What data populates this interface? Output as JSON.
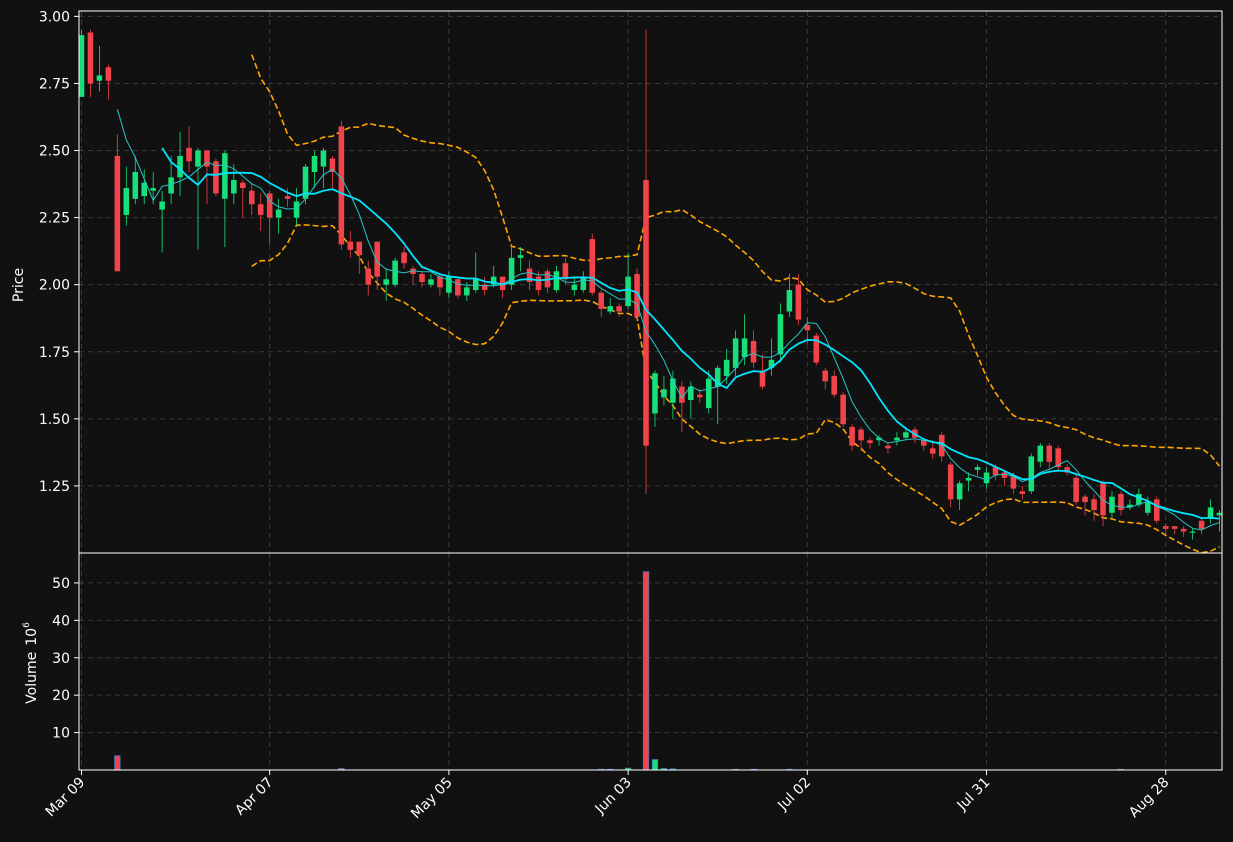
{
  "chart_data": {
    "type": "candlestick",
    "price_axis": {
      "label": "Price",
      "ylim": [
        1.0,
        3.02
      ],
      "ticks": [
        1.25,
        1.5,
        1.75,
        2.0,
        2.25,
        2.5,
        2.75,
        3.0
      ],
      "tick_labels": [
        "1.25",
        "1.50",
        "1.75",
        "2.00",
        "2.25",
        "2.50",
        "2.75",
        "3.00"
      ]
    },
    "volume_axis": {
      "label": "Volume",
      "exponent_label": "6",
      "unit_multiplier": 1000000,
      "ylim": [
        0,
        58
      ],
      "ticks": [
        10,
        20,
        30,
        40,
        50
      ],
      "tick_labels": [
        "10",
        "20",
        "30",
        "40",
        "50"
      ]
    },
    "x_axis": {
      "tick_labels": [
        "Mar 09",
        "Apr 07",
        "May 05",
        "Jun 03",
        "Jul 02",
        "Jul 31",
        "Aug 28"
      ],
      "tick_index": [
        0,
        21,
        41,
        61,
        81,
        101,
        121
      ],
      "n_bars": 128
    },
    "grid": true,
    "colors": {
      "background": "#111111",
      "up": "#17e07a",
      "down": "#f2434a",
      "ma_fast": "#26c6c6",
      "ma_slow": "#00e5ff",
      "band": "#ffa500",
      "grid": "#3a3a3a",
      "frame": "#ffffff",
      "text": "#ffffff"
    },
    "ohlc": [
      [
        2.7,
        2.93,
        2.95,
        2.7
      ],
      [
        2.94,
        2.75,
        2.95,
        2.7
      ],
      [
        2.76,
        2.78,
        2.89,
        2.72
      ],
      [
        2.81,
        2.76,
        2.82,
        2.69
      ],
      [
        2.48,
        2.05,
        2.56,
        2.05
      ],
      [
        2.26,
        2.36,
        2.44,
        2.22
      ],
      [
        2.32,
        2.42,
        2.48,
        2.3
      ],
      [
        2.33,
        2.38,
        2.43,
        2.3
      ],
      [
        2.35,
        2.36,
        2.42,
        2.3
      ],
      [
        2.28,
        2.31,
        2.35,
        2.12
      ],
      [
        2.34,
        2.4,
        2.48,
        2.3
      ],
      [
        2.4,
        2.48,
        2.57,
        2.33
      ],
      [
        2.51,
        2.46,
        2.59,
        2.42
      ],
      [
        2.44,
        2.5,
        2.51,
        2.13
      ],
      [
        2.5,
        2.44,
        2.5,
        2.3
      ],
      [
        2.46,
        2.34,
        2.47,
        2.33
      ],
      [
        2.32,
        2.49,
        2.5,
        2.14
      ],
      [
        2.34,
        2.39,
        2.45,
        2.3
      ],
      [
        2.38,
        2.36,
        2.39,
        2.25
      ],
      [
        2.35,
        2.3,
        2.38,
        2.26
      ],
      [
        2.3,
        2.26,
        2.34,
        2.2
      ],
      [
        2.34,
        2.25,
        2.35,
        2.15
      ],
      [
        2.25,
        2.28,
        2.32,
        2.19
      ],
      [
        2.33,
        2.32,
        2.36,
        2.29
      ],
      [
        2.25,
        2.31,
        2.36,
        2.22
      ],
      [
        2.32,
        2.44,
        2.45,
        2.3
      ],
      [
        2.42,
        2.48,
        2.5,
        2.36
      ],
      [
        2.44,
        2.5,
        2.51,
        2.36
      ],
      [
        2.47,
        2.42,
        2.48,
        2.36
      ],
      [
        2.59,
        2.15,
        2.61,
        2.13
      ],
      [
        2.16,
        2.13,
        2.2,
        2.1
      ],
      [
        2.16,
        2.11,
        2.16,
        2.04
      ],
      [
        2.06,
        2.0,
        2.09,
        1.96
      ],
      [
        2.16,
        2.03,
        2.16,
        1.98
      ],
      [
        2.0,
        2.02,
        2.06,
        1.94
      ],
      [
        2.0,
        2.09,
        2.1,
        1.99
      ],
      [
        2.12,
        2.08,
        2.14,
        2.06
      ],
      [
        2.06,
        2.04,
        2.07,
        2.0
      ],
      [
        2.04,
        2.01,
        2.05,
        1.99
      ],
      [
        2.0,
        2.02,
        2.04,
        1.99
      ],
      [
        2.03,
        1.99,
        2.04,
        1.96
      ],
      [
        1.97,
        2.03,
        2.05,
        1.95
      ],
      [
        2.02,
        1.96,
        2.03,
        1.95
      ],
      [
        1.96,
        1.99,
        2.01,
        1.94
      ],
      [
        1.98,
        2.02,
        2.12,
        1.97
      ],
      [
        2.0,
        1.98,
        2.03,
        1.96
      ],
      [
        2.0,
        2.03,
        2.07,
        1.99
      ],
      [
        2.03,
        1.98,
        2.03,
        1.95
      ],
      [
        2.0,
        2.1,
        2.15,
        1.98
      ],
      [
        2.1,
        2.11,
        2.14,
        2.05
      ],
      [
        2.06,
        2.01,
        2.09,
        1.98
      ],
      [
        2.03,
        1.98,
        2.05,
        1.96
      ],
      [
        2.05,
        1.99,
        2.06,
        1.97
      ],
      [
        1.98,
        2.05,
        2.07,
        1.97
      ],
      [
        2.08,
        2.02,
        2.1,
        2.0
      ],
      [
        1.98,
        2.0,
        2.03,
        1.96
      ],
      [
        1.98,
        2.03,
        2.05,
        1.97
      ],
      [
        2.17,
        1.97,
        2.19,
        1.96
      ],
      [
        1.97,
        1.91,
        1.98,
        1.88
      ],
      [
        1.9,
        1.92,
        1.95,
        1.89
      ],
      [
        1.92,
        1.9,
        1.93,
        1.88
      ],
      [
        1.92,
        2.03,
        2.12,
        1.91
      ],
      [
        2.04,
        1.88,
        2.06,
        1.87
      ],
      [
        2.39,
        1.4,
        2.95,
        1.22
      ],
      [
        1.52,
        1.67,
        1.68,
        1.47
      ],
      [
        1.58,
        1.61,
        1.66,
        1.55
      ],
      [
        1.56,
        1.65,
        1.68,
        1.5
      ],
      [
        1.62,
        1.56,
        1.64,
        1.45
      ],
      [
        1.57,
        1.62,
        1.64,
        1.5
      ],
      [
        1.59,
        1.58,
        1.61,
        1.56
      ],
      [
        1.54,
        1.65,
        1.68,
        1.52
      ],
      [
        1.62,
        1.69,
        1.7,
        1.48
      ],
      [
        1.66,
        1.72,
        1.76,
        1.63
      ],
      [
        1.69,
        1.8,
        1.83,
        1.66
      ],
      [
        1.73,
        1.8,
        1.89,
        1.7
      ],
      [
        1.79,
        1.71,
        1.83,
        1.69
      ],
      [
        1.68,
        1.62,
        1.74,
        1.61
      ],
      [
        1.69,
        1.72,
        1.8,
        1.66
      ],
      [
        1.74,
        1.89,
        1.93,
        1.71
      ],
      [
        1.9,
        1.98,
        2.04,
        1.88
      ],
      [
        2.0,
        1.87,
        2.04,
        1.85
      ],
      [
        1.85,
        1.83,
        1.88,
        1.78
      ],
      [
        1.81,
        1.71,
        1.82,
        1.7
      ],
      [
        1.68,
        1.64,
        1.69,
        1.61
      ],
      [
        1.66,
        1.59,
        1.68,
        1.58
      ],
      [
        1.59,
        1.48,
        1.6,
        1.47
      ],
      [
        1.47,
        1.4,
        1.48,
        1.38
      ],
      [
        1.46,
        1.42,
        1.47,
        1.38
      ],
      [
        1.42,
        1.41,
        1.43,
        1.39
      ],
      [
        1.42,
        1.43,
        1.44,
        1.4
      ],
      [
        1.4,
        1.39,
        1.41,
        1.37
      ],
      [
        1.42,
        1.43,
        1.45,
        1.4
      ],
      [
        1.43,
        1.45,
        1.47,
        1.42
      ],
      [
        1.46,
        1.43,
        1.47,
        1.41
      ],
      [
        1.42,
        1.4,
        1.43,
        1.38
      ],
      [
        1.39,
        1.37,
        1.41,
        1.35
      ],
      [
        1.44,
        1.36,
        1.45,
        1.34
      ],
      [
        1.33,
        1.2,
        1.34,
        1.17
      ],
      [
        1.2,
        1.26,
        1.27,
        1.16
      ],
      [
        1.27,
        1.28,
        1.3,
        1.23
      ],
      [
        1.31,
        1.32,
        1.33,
        1.29
      ],
      [
        1.26,
        1.3,
        1.32,
        1.24
      ],
      [
        1.32,
        1.29,
        1.33,
        1.27
      ],
      [
        1.3,
        1.28,
        1.31,
        1.25
      ],
      [
        1.29,
        1.24,
        1.3,
        1.22
      ],
      [
        1.23,
        1.22,
        1.25,
        1.2
      ],
      [
        1.23,
        1.36,
        1.37,
        1.22
      ],
      [
        1.34,
        1.4,
        1.41,
        1.32
      ],
      [
        1.4,
        1.34,
        1.41,
        1.31
      ],
      [
        1.39,
        1.32,
        1.4,
        1.3
      ],
      [
        1.32,
        1.3,
        1.33,
        1.29
      ],
      [
        1.28,
        1.19,
        1.29,
        1.18
      ],
      [
        1.21,
        1.19,
        1.22,
        1.14
      ],
      [
        1.2,
        1.16,
        1.22,
        1.12
      ],
      [
        1.26,
        1.14,
        1.27,
        1.1
      ],
      [
        1.15,
        1.21,
        1.23,
        1.13
      ],
      [
        1.22,
        1.16,
        1.23,
        1.14
      ],
      [
        1.17,
        1.18,
        1.2,
        1.16
      ],
      [
        1.18,
        1.22,
        1.24,
        1.17
      ],
      [
        1.15,
        1.19,
        1.21,
        1.14
      ],
      [
        1.2,
        1.12,
        1.21,
        1.11
      ],
      [
        1.1,
        1.09,
        1.11,
        1.07
      ],
      [
        1.1,
        1.09,
        1.1,
        1.07
      ],
      [
        1.09,
        1.08,
        1.1,
        1.06
      ],
      [
        1.08,
        1.08,
        1.09,
        1.05
      ],
      [
        1.12,
        1.09,
        1.13,
        1.07
      ],
      [
        1.13,
        1.17,
        1.2,
        1.11
      ],
      [
        1.14,
        1.15,
        1.16,
        1.08
      ]
    ],
    "volume": [
      0,
      0,
      0,
      0,
      3.8,
      0,
      0,
      0,
      0,
      0,
      0,
      0,
      0,
      0,
      0,
      0,
      0,
      0,
      0,
      0,
      0,
      0,
      0,
      0,
      0,
      0,
      0,
      0,
      0,
      0.4,
      0,
      0,
      0,
      0,
      0,
      0,
      0,
      0,
      0,
      0,
      0,
      0,
      0,
      0,
      0,
      0,
      0,
      0,
      0,
      0,
      0,
      0,
      0,
      0,
      0,
      0,
      0,
      0,
      0.2,
      0.2,
      0,
      0.5,
      0,
      53,
      2.8,
      0.4,
      0.3,
      0,
      0,
      0,
      0,
      0,
      0,
      0.2,
      0,
      0.2,
      0,
      0,
      0,
      0.2,
      0,
      0,
      0,
      0,
      0,
      0,
      0,
      0,
      0,
      0,
      0,
      0,
      0,
      0,
      0,
      0,
      0,
      0,
      0,
      0,
      0,
      0,
      0,
      0,
      0,
      0,
      0,
      0,
      0,
      0,
      0,
      0,
      0,
      0,
      0,
      0,
      0.2,
      0,
      0,
      0,
      0,
      0,
      0,
      0,
      0,
      0,
      0,
      0,
      0,
      0,
      0,
      0
    ],
    "overlays": {
      "ma_fast_window": 5,
      "ma_slow_window": 10,
      "band_window": 20,
      "band_std": 2
    }
  }
}
